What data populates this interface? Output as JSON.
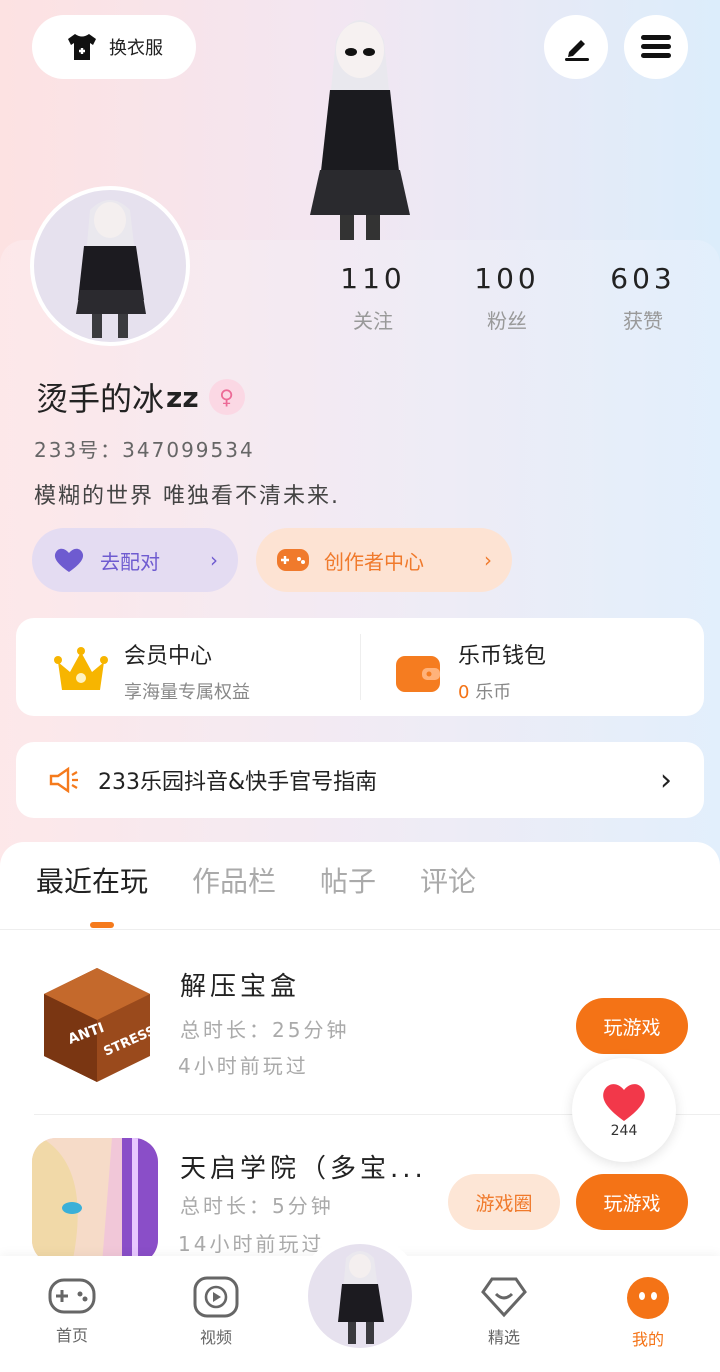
{
  "top": {
    "outfit_label": "换衣服",
    "icons": [
      "edit-icon",
      "menu-icon",
      "shirt-icon"
    ]
  },
  "profile": {
    "stats": [
      {
        "num": "110",
        "label": "关注"
      },
      {
        "num": "100",
        "label": "粉丝"
      },
      {
        "num": "603",
        "label": "获赞"
      }
    ],
    "name": "烫手的冰",
    "zz": "zz",
    "gender": "♀",
    "uid": "233号：347099534",
    "bio": "模糊的世界 唯独看不清未来."
  },
  "pills": {
    "pair": "去配对",
    "creator": "创作者中心"
  },
  "member": {
    "vip_title": "会员中心",
    "vip_sub": "享海量专属权益",
    "wallet_title": "乐币钱包",
    "wallet_amount": "0",
    "wallet_unit": "乐币"
  },
  "notice": {
    "text": "233乐园抖音&快手官号指南"
  },
  "tabs": [
    "最近在玩",
    "作品栏",
    "帖子",
    "评论"
  ],
  "games": [
    {
      "title": "解压宝盒",
      "duration": "总时长：25分钟",
      "last_played": "4小时前玩过",
      "icon_text_1": "ANTI",
      "icon_text_2": "STRESS",
      "play": "玩游戏"
    },
    {
      "title": "天启学院（多宝...",
      "duration": "总时长：5分钟",
      "last_played": "14小时前玩过",
      "circle": "游戏圈",
      "play": "玩游戏"
    }
  ],
  "like": {
    "count": "244"
  },
  "nav": [
    {
      "label": "首页"
    },
    {
      "label": "视频"
    },
    {
      "label": "精选"
    },
    {
      "label": "我的"
    }
  ],
  "colors": {
    "accent": "#f47316",
    "pair": "#6e5bd0",
    "active_nav": "#f47316"
  }
}
